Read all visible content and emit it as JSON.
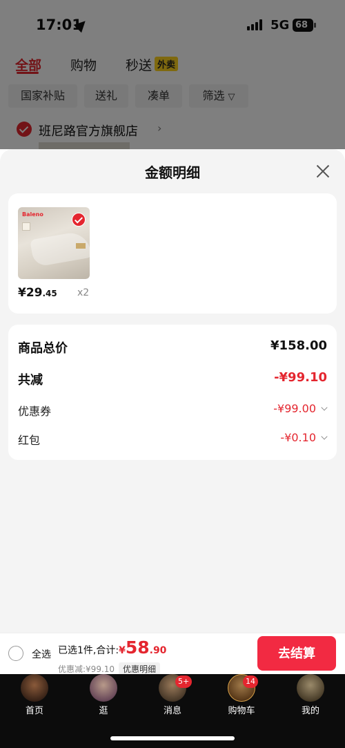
{
  "status_bar": {
    "time": "17:01",
    "network": "5G",
    "battery": "68"
  },
  "top_tabs": [
    {
      "label": "全部"
    },
    {
      "label": "购物"
    },
    {
      "label": "秒送",
      "badge": "外卖"
    }
  ],
  "filters": [
    "国家补贴",
    "送礼",
    "凑单",
    "筛选"
  ],
  "store": {
    "name": "班尼路官方旗舰店"
  },
  "sheet": {
    "title": "金额明细",
    "product": {
      "price_int": "¥29",
      "price_dec": ".45",
      "qty": "x2",
      "thumb_logo": "Baleno"
    },
    "details": {
      "total_label": "商品总价",
      "total_value": "¥158.00",
      "reduce_label": "共减",
      "reduce_value": "-¥99.10",
      "coupon_label": "优惠券",
      "coupon_value": "-¥99.00",
      "redpacket_label": "红包",
      "redpacket_value": "-¥0.10"
    }
  },
  "checkout": {
    "select_all": "全选",
    "summary_prefix": "已选1件,合计:",
    "yen": "¥",
    "amount_int": "58",
    "amount_dec": ".90",
    "discount_text": "优惠减:¥99.10",
    "detail_chip": "优惠明细",
    "button": "去结算"
  },
  "bottom_nav": [
    {
      "label": "首页",
      "badge": ""
    },
    {
      "label": "逛",
      "badge": ""
    },
    {
      "label": "消息",
      "badge": "5+"
    },
    {
      "label": "购物车",
      "badge": "14"
    },
    {
      "label": "我的",
      "badge": ""
    }
  ],
  "colors": {
    "accent": "#e4262f",
    "checkout_button": "#f22a42",
    "nav_bg": "#0c0c0c"
  }
}
